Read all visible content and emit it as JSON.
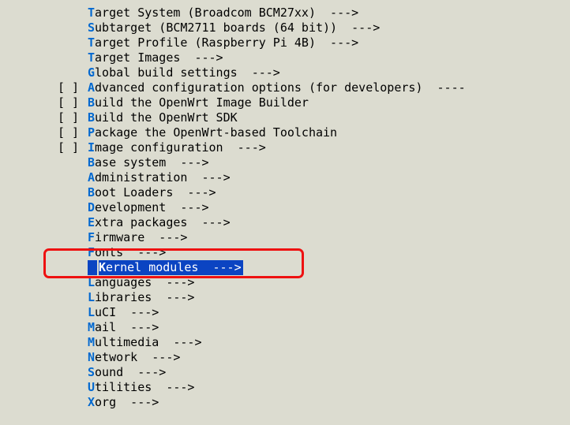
{
  "entries": [
    {
      "prefix": "    ",
      "hot": "T",
      "rest": "arget System (Broadcom BCM27xx)  --->",
      "selected": false
    },
    {
      "prefix": "    ",
      "hot": "S",
      "rest": "ubtarget (BCM2711 boards (64 bit))  --->",
      "selected": false
    },
    {
      "prefix": "    ",
      "hot": "T",
      "rest": "arget Profile (Raspberry Pi 4B)  --->",
      "selected": false
    },
    {
      "prefix": "    ",
      "hot": "T",
      "rest": "arget Images  --->",
      "selected": false
    },
    {
      "prefix": "    ",
      "hot": "G",
      "rest": "lobal build settings  --->",
      "selected": false
    },
    {
      "prefix": "[ ] ",
      "hot": "A",
      "rest": "dvanced configuration options (for developers)  ----",
      "selected": false
    },
    {
      "prefix": "[ ] ",
      "hot": "B",
      "rest": "uild the OpenWrt Image Builder",
      "selected": false
    },
    {
      "prefix": "[ ] ",
      "hot": "B",
      "rest": "uild the OpenWrt SDK",
      "selected": false
    },
    {
      "prefix": "[ ] ",
      "hot": "P",
      "rest": "ackage the OpenWrt-based Toolchain",
      "selected": false
    },
    {
      "prefix": "[ ] ",
      "hot": "I",
      "rest": "mage configuration  --->",
      "selected": false
    },
    {
      "prefix": "    ",
      "hot": "B",
      "rest": "ase system  --->",
      "selected": false
    },
    {
      "prefix": "    ",
      "hot": "A",
      "rest": "dministration  --->",
      "selected": false
    },
    {
      "prefix": "    ",
      "hot": "B",
      "rest": "oot Loaders  --->",
      "selected": false
    },
    {
      "prefix": "    ",
      "hot": "D",
      "rest": "evelopment  --->",
      "selected": false
    },
    {
      "prefix": "    ",
      "hot": "E",
      "rest": "xtra packages  --->",
      "selected": false
    },
    {
      "prefix": "    ",
      "hot": "F",
      "rest": "irmware  --->",
      "selected": false
    },
    {
      "prefix": "    ",
      "hot": "F",
      "rest": "onts  --->",
      "selected": false
    },
    {
      "prefix": "    ",
      "hot": "K",
      "rest": "ernel modules  --->",
      "selected": true
    },
    {
      "prefix": "    ",
      "hot": "L",
      "rest": "anguages  --->",
      "selected": false
    },
    {
      "prefix": "    ",
      "hot": "L",
      "rest": "ibraries  --->",
      "selected": false
    },
    {
      "prefix": "    ",
      "hot": "L",
      "rest": "uCI  --->",
      "selected": false
    },
    {
      "prefix": "    ",
      "hot": "M",
      "rest": "ail  --->",
      "selected": false
    },
    {
      "prefix": "    ",
      "hot": "M",
      "rest": "ultimedia  --->",
      "selected": false
    },
    {
      "prefix": "    ",
      "hot": "N",
      "rest": "etwork  --->",
      "selected": false
    },
    {
      "prefix": "    ",
      "hot": "S",
      "rest": "ound  --->",
      "selected": false
    },
    {
      "prefix": "    ",
      "hot": "U",
      "rest": "tilities  --->",
      "selected": false
    },
    {
      "prefix": "    ",
      "hot": "X",
      "rest": "org  --->",
      "selected": false
    }
  ]
}
